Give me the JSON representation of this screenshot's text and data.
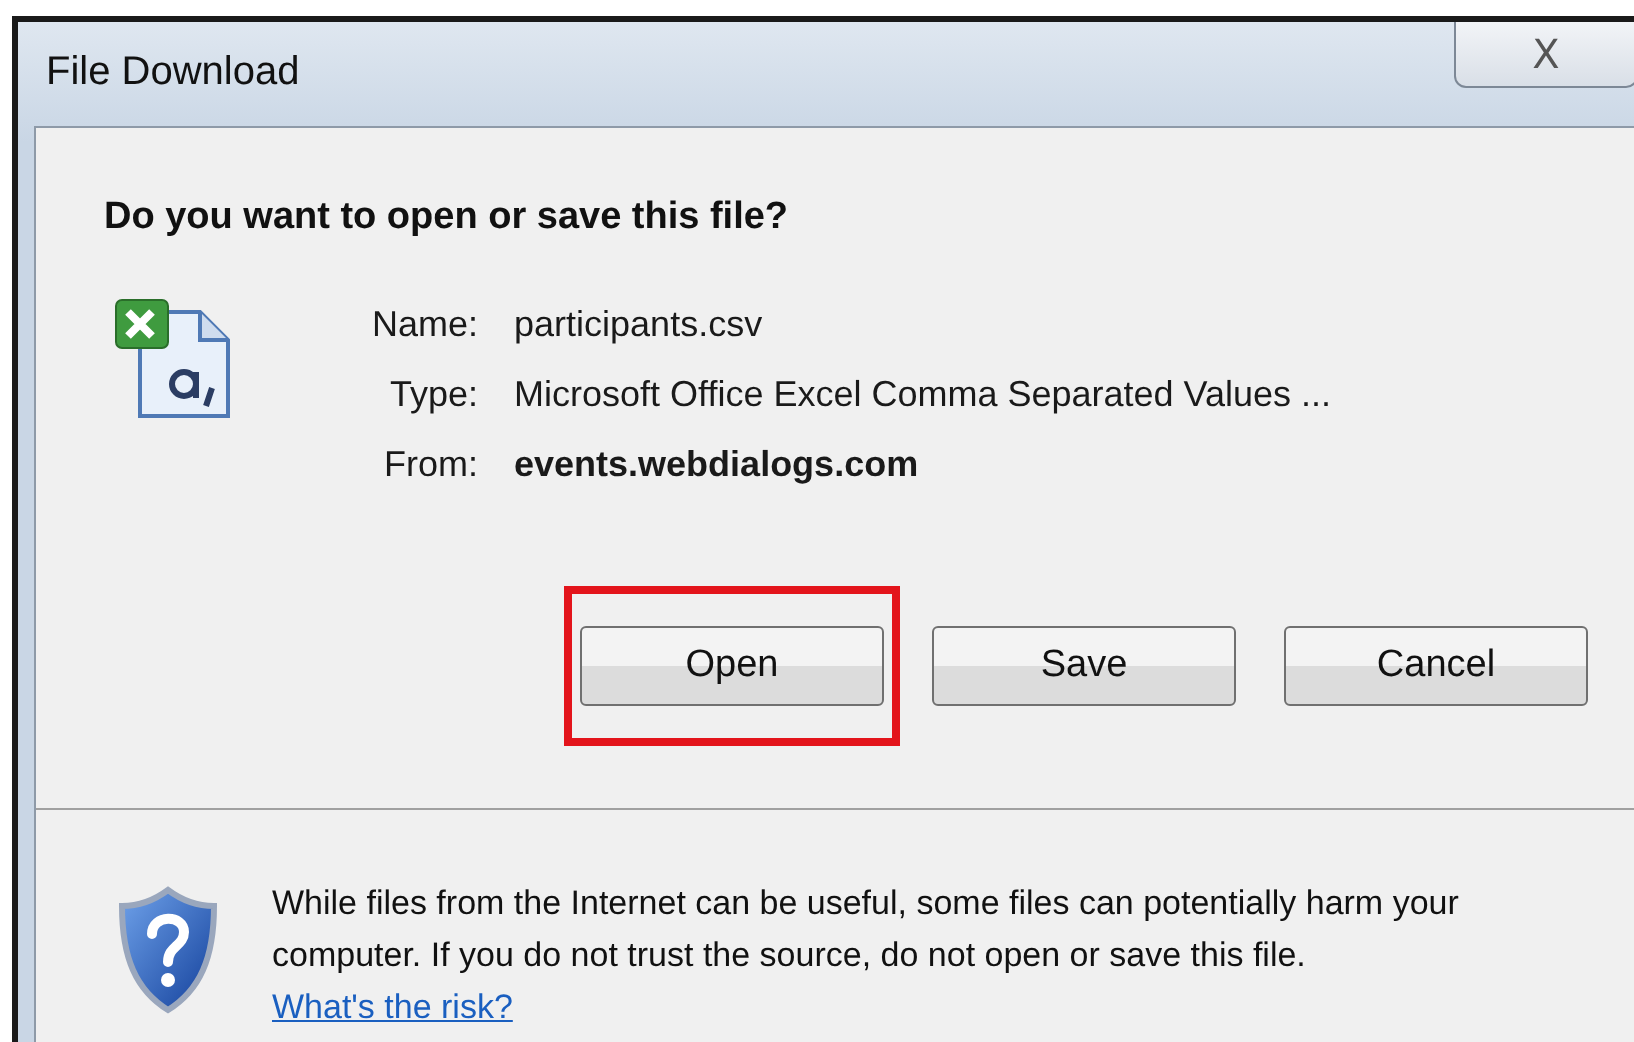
{
  "window": {
    "title": "File Download",
    "close": "X"
  },
  "question": "Do you want to open or save this file?",
  "fields": [
    {
      "label": "Name:",
      "value": "participants.csv",
      "bold": false
    },
    {
      "label": "Type:",
      "value": "Microsoft Office Excel Comma Separated Values ...",
      "bold": false
    },
    {
      "label": "From:",
      "value": "events.webdialogs.com",
      "bold": true
    }
  ],
  "buttons": [
    {
      "label": "Open",
      "highlighted": true
    },
    {
      "label": "Save",
      "highlighted": false
    },
    {
      "label": "Cancel",
      "highlighted": false
    }
  ],
  "warning": {
    "text": "While files from the Internet can be useful, some files can potentially harm your computer. If you do not trust the source, do not open or save this file.",
    "link": "What's the risk?"
  }
}
